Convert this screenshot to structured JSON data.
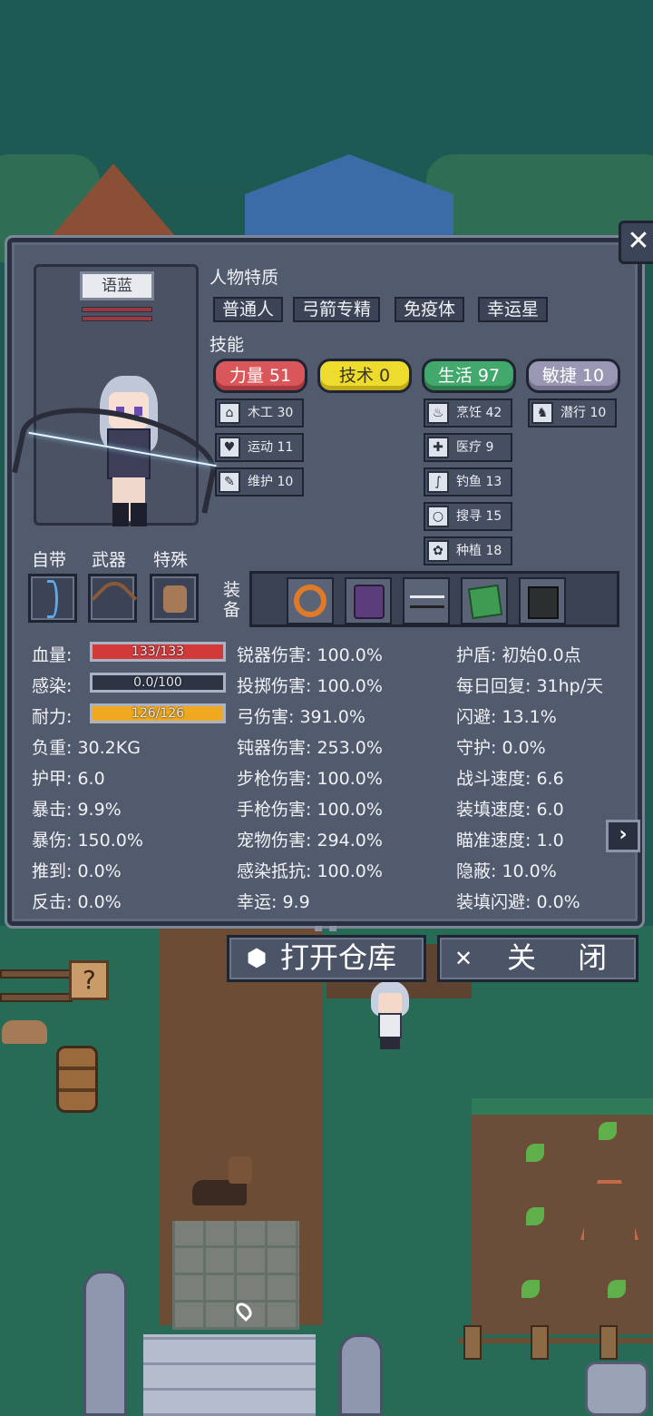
{
  "character": {
    "name": "语蓝"
  },
  "traits": {
    "title": "人物特质",
    "items": [
      "普通人",
      "弓箭专精",
      "免疫体",
      "幸运星"
    ]
  },
  "skills": {
    "title": "技能",
    "categories": {
      "strength": {
        "label": "力量 51",
        "color": "#d9575a"
      },
      "technique": {
        "label": "技术 0",
        "color": "#eddc2e"
      },
      "living": {
        "label": "生活 97",
        "color": "#43a86b"
      },
      "agility": {
        "label": "敏捷 10",
        "color": "#9a97b5"
      }
    },
    "strength_skills": [
      {
        "label": "木工 30",
        "icon": "house-icon"
      },
      {
        "label": "运动 11",
        "icon": "heart-icon"
      },
      {
        "label": "维护 10",
        "icon": "wrench-icon"
      }
    ],
    "living_skills": [
      {
        "label": "烹饪 42",
        "icon": "cooking-pot-icon"
      },
      {
        "label": "医疗 9",
        "icon": "medkit-icon"
      },
      {
        "label": "钓鱼 13",
        "icon": "fishing-icon"
      },
      {
        "label": "搜寻 15",
        "icon": "magnifier-icon"
      },
      {
        "label": "种植 18",
        "icon": "plant-icon"
      }
    ],
    "agility_skills": [
      {
        "label": "潜行 10",
        "icon": "sneak-icon"
      }
    ]
  },
  "slots": {
    "carry_label": "自带",
    "weapon_label": "武器",
    "special_label": "特殊",
    "equip_label": "装备"
  },
  "vitals": {
    "hp_label": "血量:",
    "hp_value": "133/133",
    "hp_fraction": 1.0,
    "infection_label": "感染:",
    "infection_value": "0.0/100",
    "infection_fraction": 0.0,
    "stamina_label": "耐力:",
    "stamina_value": "126/126",
    "stamina_fraction": 1.0
  },
  "stats_col1": [
    "负重: 30.2KG",
    "护甲: 6.0",
    "暴击: 9.9%",
    "暴伤: 150.0%",
    "推到: 0.0%",
    "反击: 0.0%"
  ],
  "stats_col2": [
    "锐器伤害: 100.0%",
    "投掷伤害: 100.0%",
    "弓伤害: 391.0%",
    "钝器伤害: 253.0%",
    "步枪伤害: 100.0%",
    "手枪伤害: 100.0%",
    "宠物伤害: 294.0%",
    "感染抵抗: 100.0%",
    "幸运: 9.9"
  ],
  "stats_col3": [
    "护盾: 初始0.0点",
    "每日回复: 31hp/天",
    "闪避: 13.1%",
    "守护: 0.0%",
    "战斗速度: 6.6",
    "装填速度: 6.0",
    "瞄准速度: 1.0",
    "隐蔽: 10.0%",
    "装填闪避: 0.0%"
  ],
  "buttons": {
    "open_storage": "打开仓库",
    "close": "关 闭",
    "close_x": "✕",
    "next": "›"
  },
  "colors": {
    "hp_fill": "#d23a3a",
    "infection_fill": "#5a6276",
    "stamina_fill": "#f0a820",
    "panel": "#525b6d"
  }
}
